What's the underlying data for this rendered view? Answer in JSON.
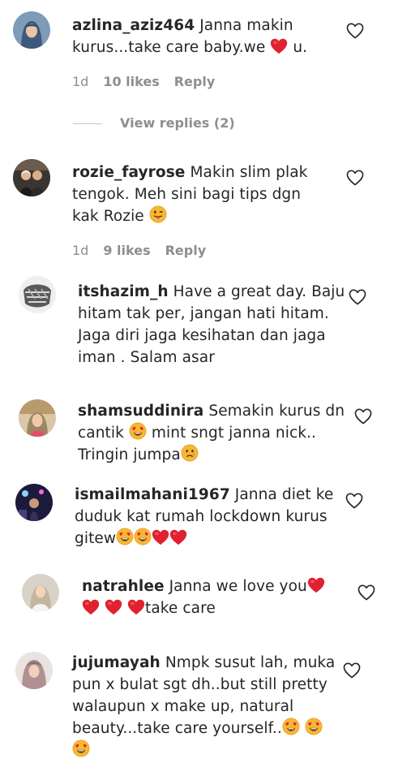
{
  "comments": [
    {
      "username": "azlina_aziz464",
      "text_a": " Janna makin",
      "text_b": "kurus...take care baby.we ",
      "text_c": " u.",
      "age": "1d",
      "likes": "10 likes",
      "reply": "Reply",
      "view_replies": "View replies (2)"
    },
    {
      "username": "rozie_fayrose",
      "text_a": " Makin slim plak",
      "text_b": "tengok. Meh sini bagi tips dgn",
      "text_c": "kak Rozie ",
      "age": "1d",
      "likes": "9 likes",
      "reply": "Reply"
    },
    {
      "username": "itshazim_h",
      "text_a": " Have a great day. Baju",
      "text_b": "hitam tak per, jangan hati hitam.",
      "text_c": "Jaga diri jaga kesihatan dan jaga",
      "text_d": "iman . Salam asar"
    },
    {
      "username": "shamsuddinira",
      "text_a": " Semakin kurus dn",
      "text_b1": "cantik ",
      "text_b2": " mint sngt janna nick..",
      "text_c": "Tringin jumpa"
    },
    {
      "username": "ismailmahani1967",
      "text_a": " Janna diet ke",
      "text_b": "duduk kat rumah lockdown kurus",
      "text_c": "gitew"
    },
    {
      "username": "natrahlee",
      "text_a": " Janna we love you",
      "text_b": "take care"
    },
    {
      "username": "jujumayah",
      "text_a": " Nmpk susut lah, muka",
      "text_b": "pun x bulat sgt dh..but still pretty",
      "text_c": "walaupun x make up, natural",
      "text_d": "beauty...take care yourself.."
    }
  ]
}
